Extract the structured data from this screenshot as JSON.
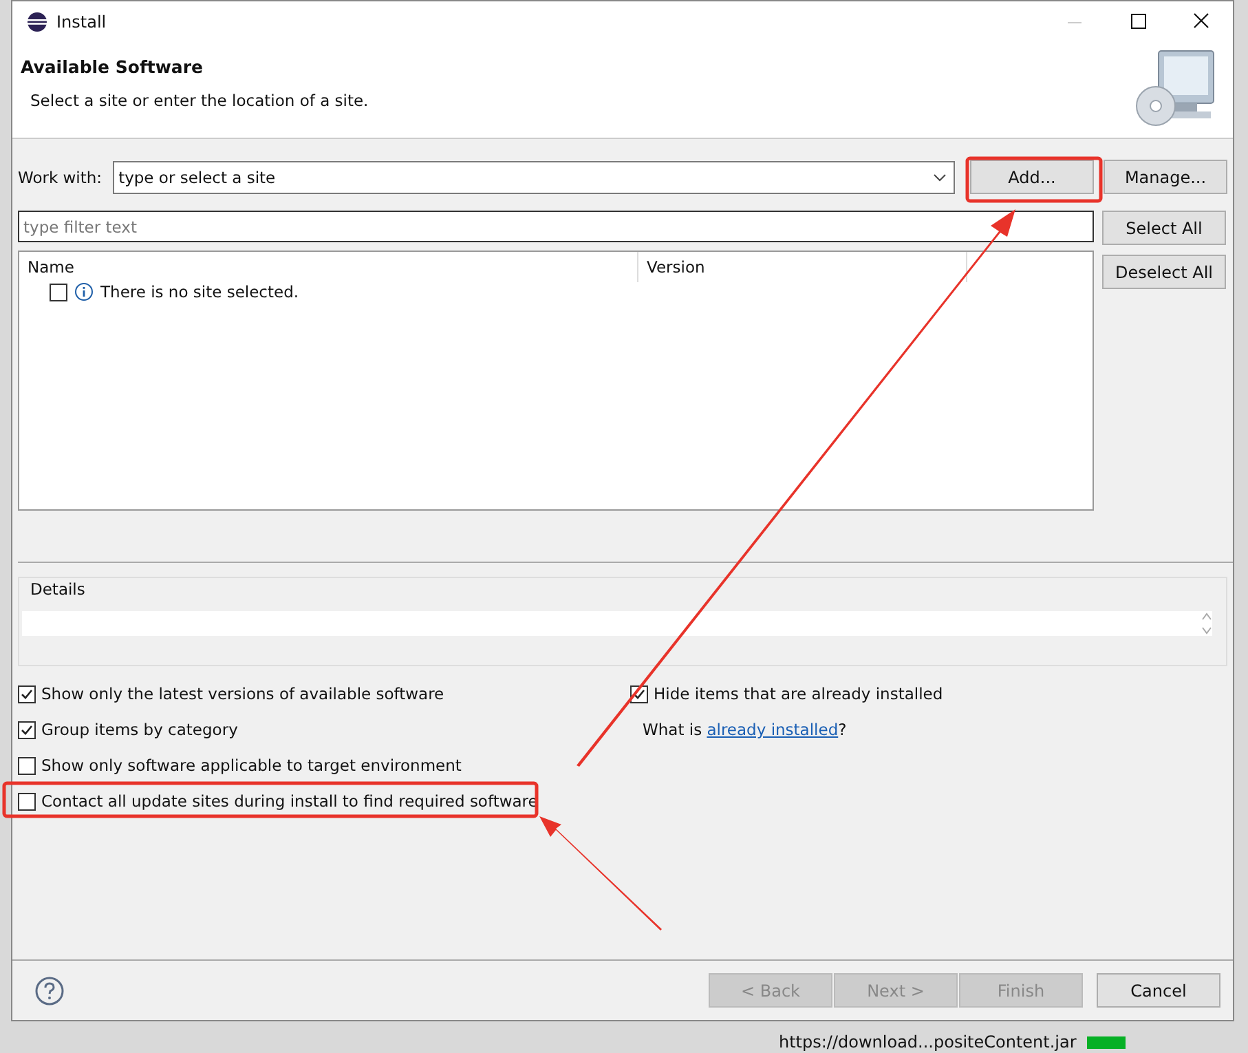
{
  "window": {
    "title": "Install"
  },
  "header": {
    "title": "Available Software",
    "subtitle": "Select a site or enter the location of a site."
  },
  "work_with": {
    "label": "Work with:",
    "placeholder": "type or select a site"
  },
  "side_buttons": [
    {
      "label": "Add..."
    },
    {
      "label": "Manage..."
    }
  ],
  "filter": {
    "placeholder": "type filter text"
  },
  "list_buttons": [
    {
      "label": "Select All"
    },
    {
      "label": "Deselect All"
    }
  ],
  "table": {
    "columns": [
      "Name",
      "Version"
    ],
    "rows": [
      {
        "checked": false,
        "text": "There is no site selected."
      }
    ]
  },
  "details": {
    "label": "Details"
  },
  "options_left": [
    {
      "label": "Show only the latest versions of available software",
      "checked": true
    },
    {
      "label": "Group items by category",
      "checked": true
    },
    {
      "label": "Show only software applicable to target environment",
      "checked": false
    },
    {
      "label": "Contact all update sites during install to find required software",
      "checked": false
    }
  ],
  "options_right": [
    {
      "label": "Hide items that are already installed",
      "checked": true
    }
  ],
  "installed_note": {
    "prefix": "What is ",
    "link": "already installed",
    "suffix": "?"
  },
  "wizard_buttons": [
    {
      "label": "< Back",
      "disabled": true
    },
    {
      "label": "Next >",
      "disabled": true
    },
    {
      "label": "Finish",
      "disabled": true
    },
    {
      "label": "Cancel",
      "disabled": false
    }
  ],
  "background_status": {
    "text": "https://download...positeContent.jar",
    "level": 1
  }
}
